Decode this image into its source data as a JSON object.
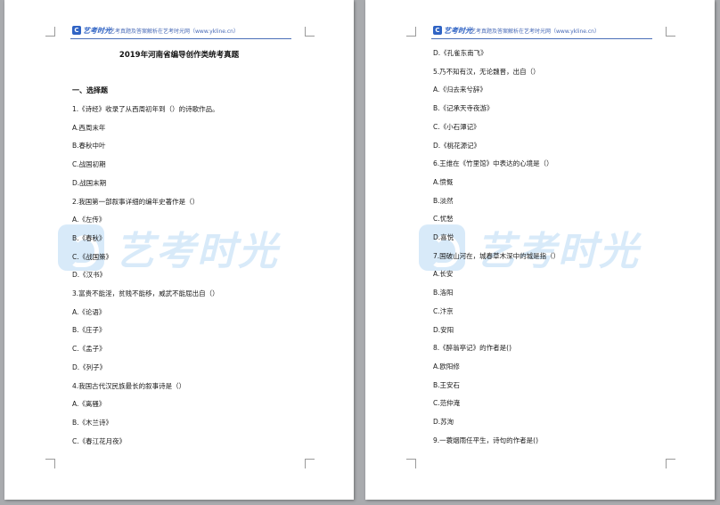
{
  "header": {
    "logo_text": "艺考时光",
    "tagline": "艺考真题及答案解析在艺考时光网（www.ykline.cn）"
  },
  "watermark": {
    "text": "艺考时光"
  },
  "page_left": {
    "title": "2019年河南省编导创作类统考真题",
    "section": "一、选择题",
    "lines": [
      "1.《诗经》收录了从西周初年到（）的诗歌作品。",
      "A.西周末年",
      "B.春秋中叶",
      "C.战国初期",
      "D.战国末期",
      "2.我国第一部叙事详细的编年史著作是（）",
      "A.《左传》",
      "B.《春秋》",
      "C.《战国策》",
      "D.《汉书》",
      "3.富贵不能淫，贫贱不能移，威武不能屈出自（）",
      "A.《论语》",
      "B.《庄子》",
      "C.《孟子》",
      "D.《列子》",
      "4.我国古代汉民族最长的叙事诗是（）",
      "A.《离骚》",
      "B.《木兰诗》",
      "C.《春江花月夜》"
    ]
  },
  "page_right": {
    "lines": [
      "D.《孔雀东南飞》",
      "5.乃不知有汉，无论魏晋，出自（）",
      "A.《归去来兮辞》",
      "B.《记承天寺夜游》",
      "C.《小石潭记》",
      "D.《桃花源记》",
      "6.王维在《竹里馆》中表达的心境是（）",
      "A.愤慨",
      "B.淡然",
      "C.忧愁",
      "D.喜悦",
      "7.国破山河在，城春草木深中的城是指（）",
      "A.长安",
      "B.洛阳",
      "C.汴京",
      "D.安阳",
      "8.《醉翁亭记》的作者是()",
      "A.欧阳修",
      "B.王安石",
      "C.范仲淹",
      "D.苏洵",
      "9.一蓑烟雨任平生，诗句的作者是()"
    ]
  }
}
